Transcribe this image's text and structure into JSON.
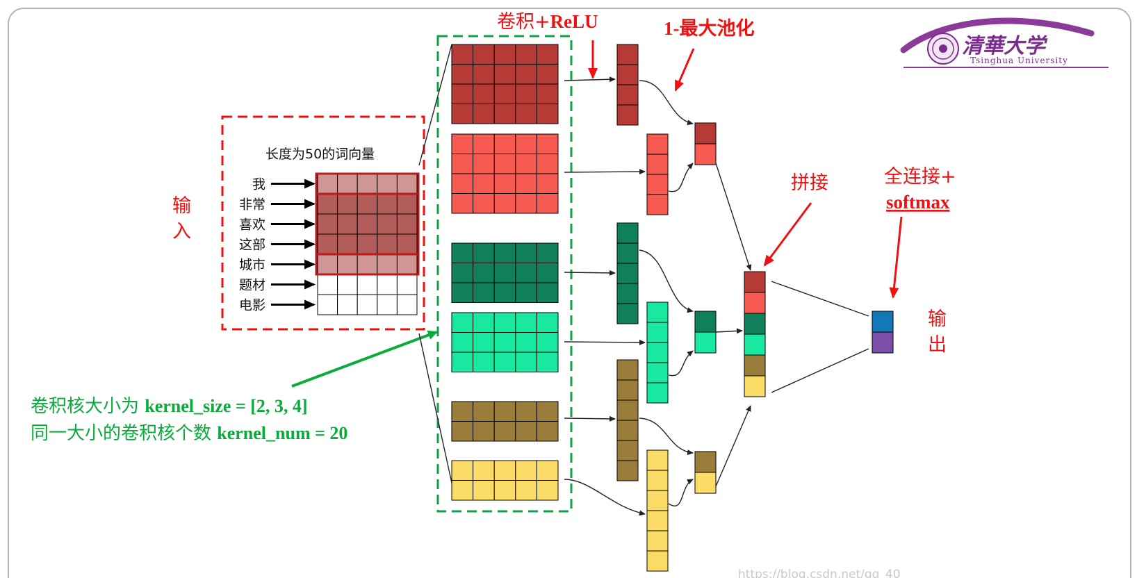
{
  "logo": {
    "cn": "清華大学",
    "en": "Tsinghua University",
    "color": "#7a2d8a"
  },
  "labels": {
    "conv_prefix": "卷积+",
    "conv_relu": "ReLU",
    "maxpool": "1-最大池化",
    "concat": "拼接",
    "fc": "全连接+",
    "softmax": "softmax",
    "input_1": "输",
    "input_2": "入",
    "output_1": "输",
    "output_2": "出",
    "vector_caption": "长度为50的词向量",
    "kernel_line1_prefix": "卷积核大小为 ",
    "kernel_line1_bold": "kernel_size",
    "kernel_line1_value": " = [2, 3, 4]",
    "kernel_line2_prefix": "同一大小的卷积核个数 ",
    "kernel_line2_bold": "kernel_num",
    "kernel_line2_value": " = 20"
  },
  "words": [
    "我",
    "非常",
    "喜欢",
    "这部",
    "城市",
    "题材",
    "电影"
  ],
  "watermark": "https://blog.csdn.net/qq_40",
  "colors": {
    "dark_red": "#b63a36",
    "red": "#f75a50",
    "dark_green": "#10805a",
    "light_green": "#18e8a0",
    "olive": "#9a7d3a",
    "yellow": "#fbdc66",
    "blue": "#1477b6",
    "purple": "#7b4ea8",
    "annotation_red": "#ee1111",
    "annotation_green": "#0aab3c",
    "highlight": "#b25d59"
  }
}
